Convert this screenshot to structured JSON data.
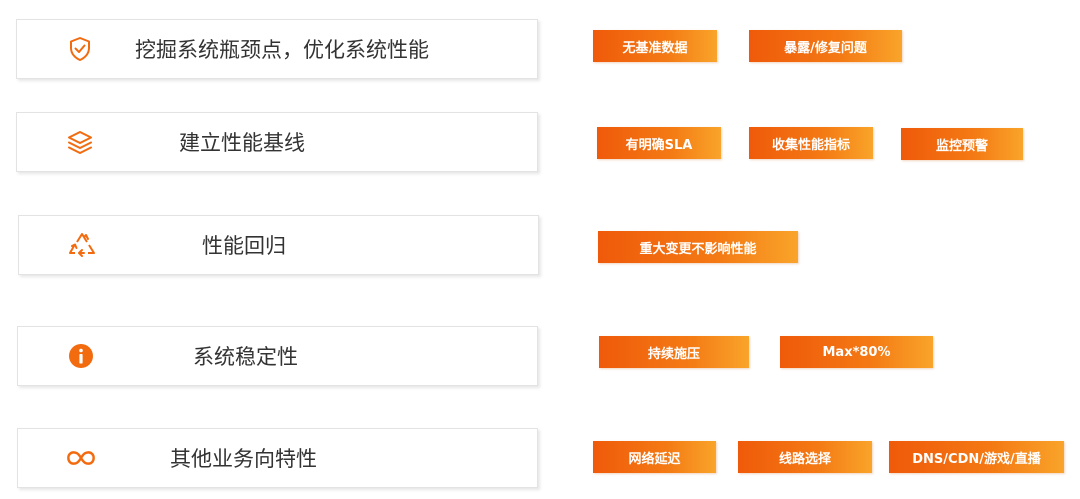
{
  "rows": [
    {
      "icon": "shield-check-icon",
      "label": "挖掘系统瓶颈点，优化系统性能",
      "tags": [
        "无基准数据",
        "暴露/修复问题"
      ]
    },
    {
      "icon": "layers-icon",
      "label": "建立性能基线",
      "tags": [
        "有明确SLA",
        "收集性能指标",
        "监控预警"
      ]
    },
    {
      "icon": "recycle-icon",
      "label": "性能回归",
      "tags": [
        "重大变更不影响性能"
      ]
    },
    {
      "icon": "info-icon",
      "label": "系统稳定性",
      "tags": [
        "持续施压",
        "Max*80%"
      ]
    },
    {
      "icon": "infinity-icon",
      "label": "其他业务向特性",
      "tags": [
        "网络延迟",
        "线路选择",
        "DNS/CDN/游戏/直播"
      ]
    }
  ],
  "colors": {
    "accent": "#f26b0f",
    "tag_gradient_start": "#ef5a0a",
    "tag_gradient_end": "#f9a42a",
    "label_text": "#333333"
  }
}
